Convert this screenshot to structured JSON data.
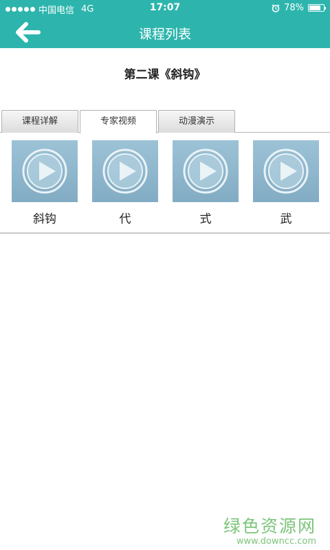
{
  "status_bar": {
    "carrier": "中国电信",
    "network": "4G",
    "time": "17:07",
    "battery": "78%",
    "battery_level": 0.78
  },
  "nav": {
    "title": "课程列表",
    "back_icon": "arrow-left-icon"
  },
  "lesson": {
    "title": "第二课《斜钩》"
  },
  "tabs": [
    {
      "label": "课程详解",
      "active": false
    },
    {
      "label": "专家视频",
      "active": true
    },
    {
      "label": "动漫演示",
      "active": false
    }
  ],
  "videos": [
    {
      "label": "斜钩",
      "icon": "play-icon"
    },
    {
      "label": "代",
      "icon": "play-icon"
    },
    {
      "label": "式",
      "icon": "play-icon"
    },
    {
      "label": "武",
      "icon": "play-icon"
    }
  ],
  "watermark": {
    "main": "绿色资源网",
    "sub": "www.downcc.com"
  },
  "colors": {
    "header": "#2db5ad",
    "thumbnail": "#8fb8cd",
    "watermark": "#7cc47a"
  }
}
